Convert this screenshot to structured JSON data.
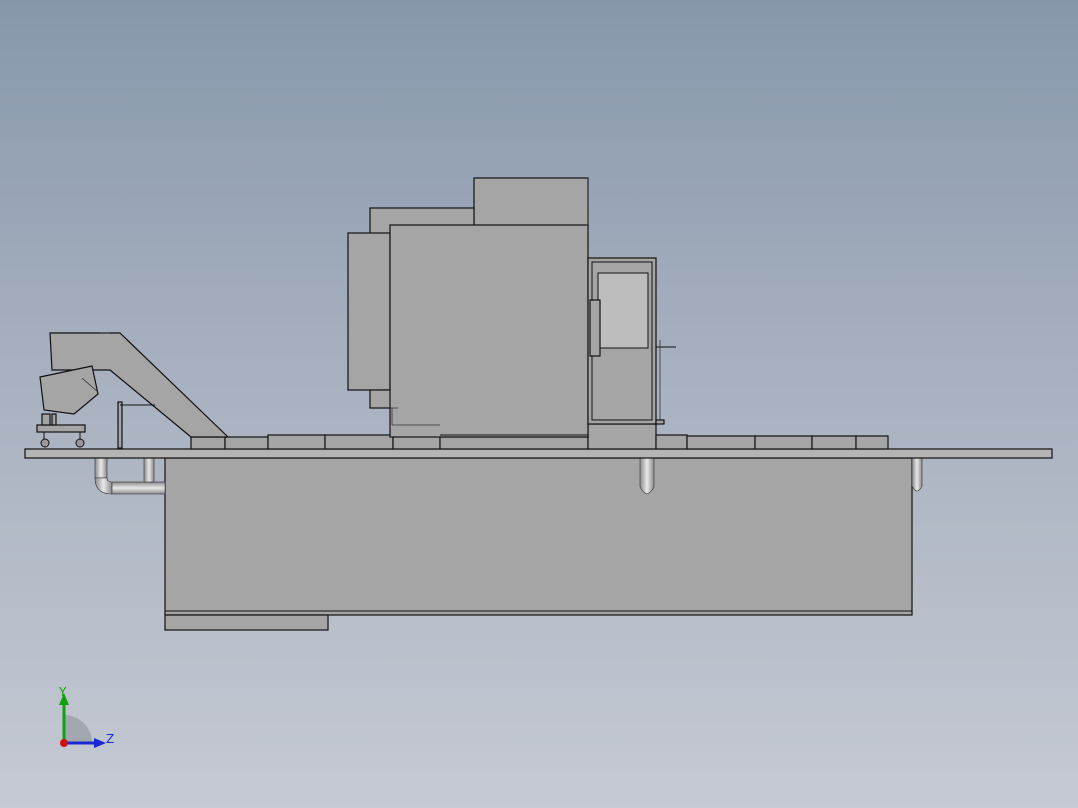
{
  "triad": {
    "y_label": "Y",
    "z_label": "Z",
    "colors": {
      "y_axis": "#10a010",
      "z_axis": "#1a2ad0",
      "x_axis": "#d01010"
    }
  },
  "colors": {
    "background_top": "#8797ab",
    "background_bottom": "#c5cad3",
    "part_fill": "#a5a5a5",
    "edge": "#111111"
  }
}
